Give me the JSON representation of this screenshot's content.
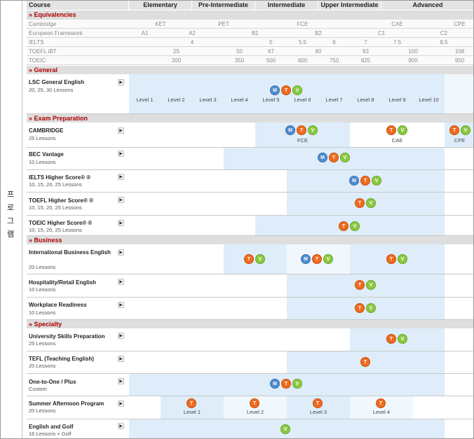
{
  "vertical_label": "프로그램",
  "header": {
    "course": "Course",
    "bands": [
      "Elementary",
      "Pre-Intermediate",
      "Intermediate",
      "Upper Intermediate",
      "Advanced"
    ]
  },
  "sections": {
    "equivalencies": "» Equivalencies",
    "general": "» General",
    "exam": "» Exam Preparation",
    "business": "» Business",
    "specialty": "» Specialty"
  },
  "equivalencies": [
    {
      "label": "Cambridge",
      "values": [
        "KET",
        "PET",
        "FCE",
        "CAE",
        "CPE"
      ]
    },
    {
      "label": "European Framework",
      "values": [
        "A1",
        "A2",
        "B1",
        "B2",
        "C1",
        "C2"
      ]
    },
    {
      "label": "IELTS",
      "values": [
        "4",
        "5",
        "5.5",
        "6",
        "7",
        "7.5",
        "8.5"
      ]
    },
    {
      "label": "TOEFL iBT",
      "values": [
        "25",
        "50",
        "67",
        "80",
        "93",
        "100",
        "108"
      ]
    },
    {
      "label": "TOEIC",
      "values": [
        "200",
        "350",
        "500",
        "600",
        "750",
        "825",
        "900",
        "950"
      ]
    }
  ],
  "levels": [
    "Level 1",
    "Level 2",
    "Level 3",
    "Level 4",
    "Level 5",
    "Level 6",
    "Level 7",
    "Level 8",
    "Level 9",
    "Level 10"
  ],
  "summer_levels": [
    "Level 1",
    "Level 2",
    "Level 3",
    "Level 4"
  ],
  "courses": {
    "lsc": {
      "title": "LSC General English",
      "sub": "20, 25, 30 Lessons"
    },
    "cambridge": {
      "title": "CAMBRIDGE",
      "sub": "25 Lessons",
      "labels": [
        "FCE",
        "CAE",
        "CPE"
      ]
    },
    "bec": {
      "title": "BEC Vantage",
      "sub": "10 Lessons"
    },
    "ielts": {
      "title": "IELTS Higher Score® ®",
      "sub": "10, 15, 20, 25 Lessons"
    },
    "toefl": {
      "title": "TOEFL Higher Score® ®",
      "sub": "10, 15, 20, 25 Lessons"
    },
    "toeic": {
      "title": "TOEIC Higher Score® ®",
      "sub": "10, 15, 20, 25 Lessons"
    },
    "ibe": {
      "title": "International Business English",
      "sub": "20 Lessons"
    },
    "hosp": {
      "title": "Hospitality/Retail English",
      "sub": "10 Lessons"
    },
    "work": {
      "title": "Workplace Readiness",
      "sub": "10 Lessons"
    },
    "univ": {
      "title": "University Skills Preparation",
      "sub": "25 Lessons"
    },
    "tefl": {
      "title": "TEFL (Teaching English)",
      "sub": "20 Lessons"
    },
    "one": {
      "title": "One-to-One / Plus",
      "sub": "Custom"
    },
    "summer": {
      "title": "Summer Afternoon Program",
      "sub": "20 Lessons"
    },
    "golf": {
      "title": "English and Golf",
      "sub": "16 Lessons + Golf"
    }
  },
  "badges": {
    "M": "M",
    "T": "T",
    "V": "V"
  },
  "arrow_glyph": "▶",
  "colors": {
    "section_text": "#b00000",
    "band_blue": "#deedf9",
    "badge_m": "#4f8bd0",
    "badge_t": "#f06a1f",
    "badge_v": "#8ac940"
  }
}
